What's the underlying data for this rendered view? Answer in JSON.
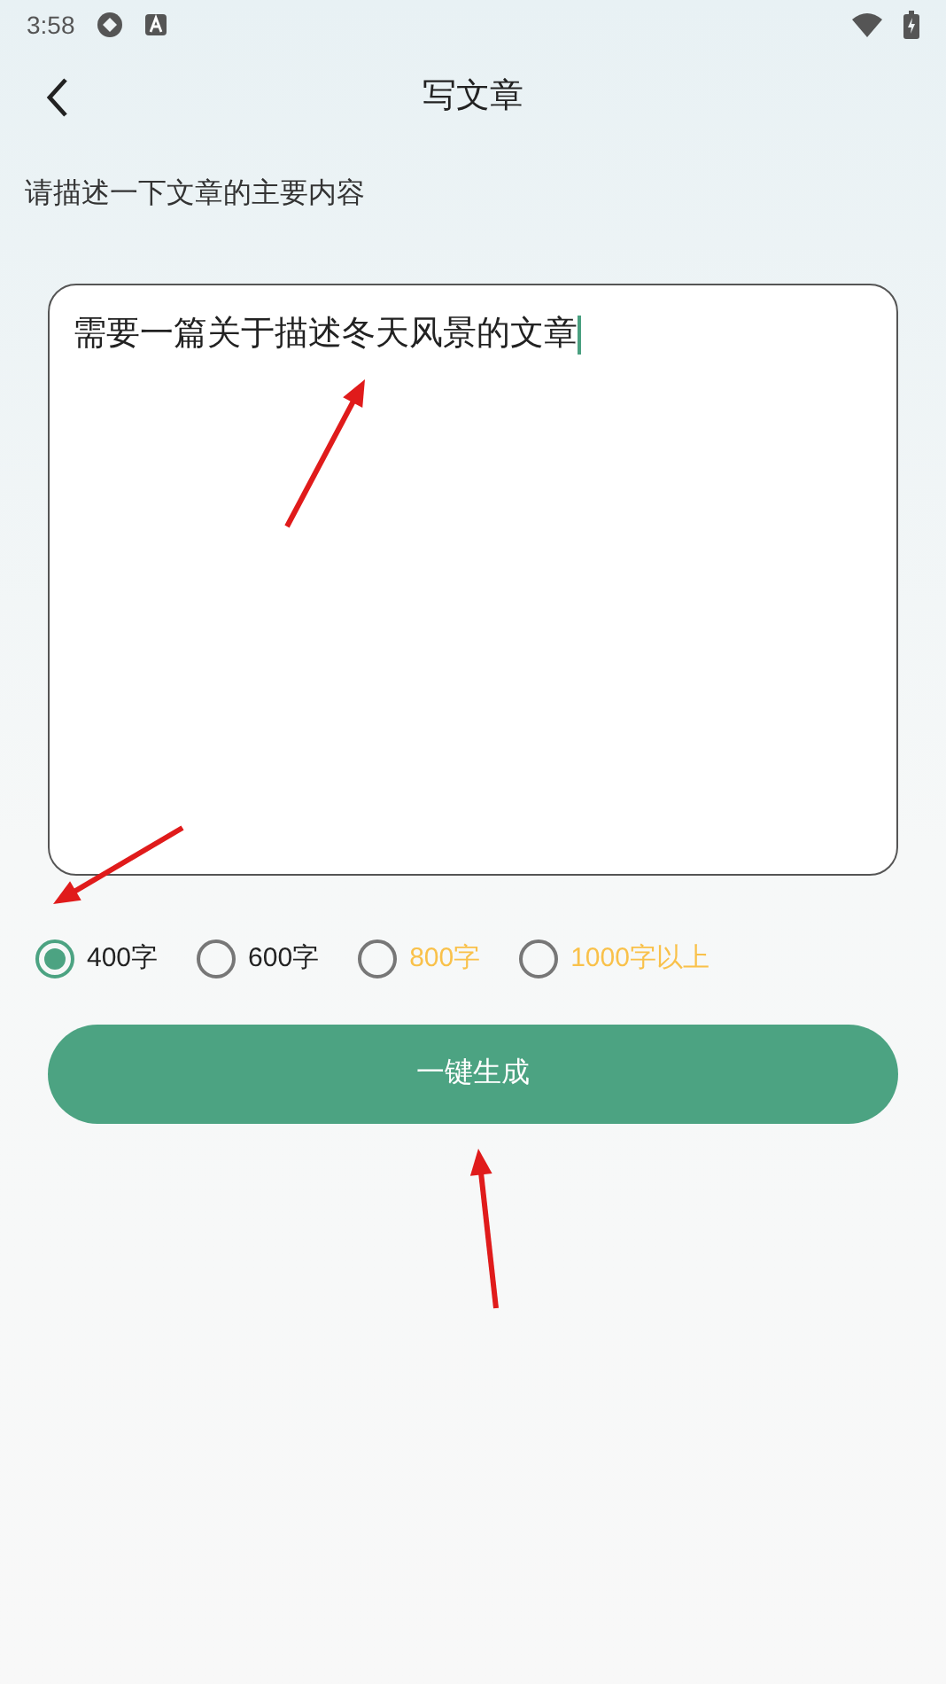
{
  "status_bar": {
    "time": "3:58"
  },
  "header": {
    "title": "写文章"
  },
  "prompt": "请描述一下文章的主要内容",
  "editor": {
    "value": "需要一篇关于描述冬天风景的文章"
  },
  "length_options": [
    {
      "label": "400字",
      "selected": true,
      "color": "#222222"
    },
    {
      "label": "600字",
      "selected": false,
      "color": "#222222"
    },
    {
      "label": "800字",
      "selected": false,
      "color": "#f9c14a"
    },
    {
      "label": "1000字以上",
      "selected": false,
      "color": "#f9c14a"
    }
  ],
  "generate_button": "一键生成"
}
